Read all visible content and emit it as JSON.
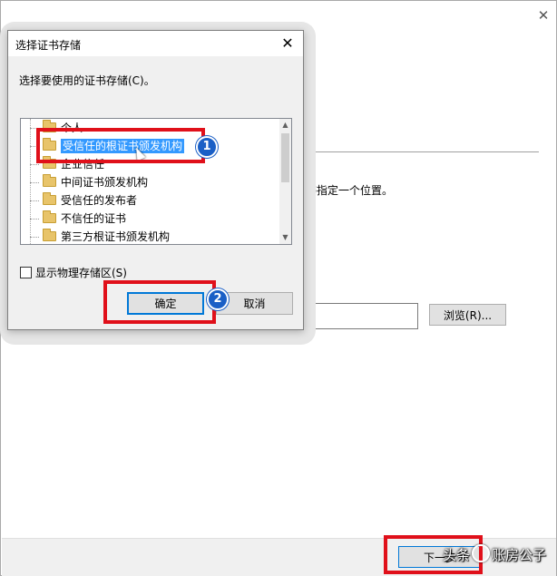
{
  "wizard": {
    "close_glyph": "✕",
    "location_text": "书指定一个位置。",
    "browse_label": "浏览(R)...",
    "next_label": "下一步"
  },
  "dialog": {
    "title": "选择证书存储",
    "close_glyph": "✕",
    "prompt": "选择要使用的证书存储(C)。",
    "stores": [
      {
        "label": "个人"
      },
      {
        "label": "受信任的根证书颁发机构",
        "selected": true
      },
      {
        "label": "企业信任"
      },
      {
        "label": "中间证书颁发机构"
      },
      {
        "label": "受信任的发布者"
      },
      {
        "label": "不信任的证书"
      },
      {
        "label": "第三方根证书颁发机构"
      }
    ],
    "show_physical_label": "显示物理存储区(S)",
    "show_physical_checked": false,
    "ok_label": "确定",
    "cancel_label": "取消"
  },
  "annotations": {
    "marker1": "1",
    "marker2": "2"
  },
  "watermark": {
    "text_left": "头条",
    "text_right": "账房公子"
  },
  "colors": {
    "selection": "#3399ff",
    "annotation_red": "#e0101a",
    "marker_blue": "#1a5fc6",
    "folder_yellow": "#e8c46a"
  }
}
